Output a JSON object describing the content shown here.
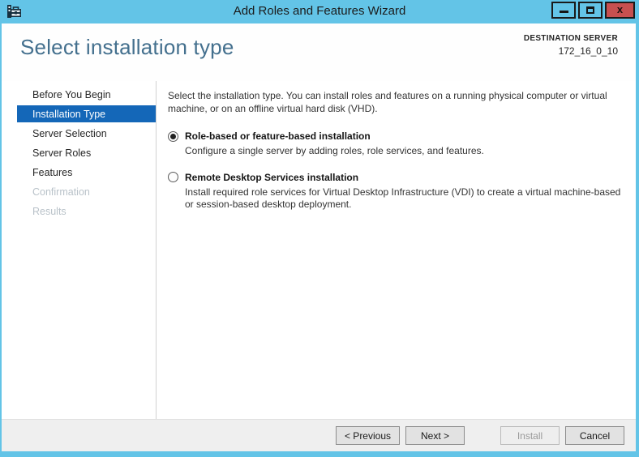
{
  "window": {
    "title": "Add Roles and Features Wizard",
    "controls": {
      "minimize_icon": "minimize-dash",
      "maximize_icon": "maximize-square",
      "close_label": "x"
    }
  },
  "header": {
    "title": "Select installation type",
    "destination_label": "DESTINATION SERVER",
    "destination_value": "172_16_0_10"
  },
  "sidebar": {
    "items": [
      {
        "label": "Before You Begin",
        "state": "enabled"
      },
      {
        "label": "Installation Type",
        "state": "selected"
      },
      {
        "label": "Server Selection",
        "state": "enabled"
      },
      {
        "label": "Server Roles",
        "state": "enabled"
      },
      {
        "label": "Features",
        "state": "enabled"
      },
      {
        "label": "Confirmation",
        "state": "disabled"
      },
      {
        "label": "Results",
        "state": "disabled"
      }
    ]
  },
  "main": {
    "intro": "Select the installation type. You can install roles and features on a running physical computer or virtual machine, or on an offline virtual hard disk (VHD).",
    "options": [
      {
        "label": "Role-based or feature-based installation",
        "description": "Configure a single server by adding roles, role services, and features.",
        "selected": true
      },
      {
        "label": "Remote Desktop Services installation",
        "description": "Install required role services for Virtual Desktop Infrastructure (VDI) to create a virtual machine-based or session-based desktop deployment.",
        "selected": false
      }
    ]
  },
  "footer": {
    "previous_label": "< Previous",
    "next_label": "Next >",
    "install_label": "Install",
    "cancel_label": "Cancel",
    "install_enabled": false
  },
  "colors": {
    "titlebar": "#63c4e7",
    "close_button": "#c75050",
    "header_title": "#44708e",
    "nav_selected_bg": "#1467b8",
    "disabled_text": "#b9c2c9"
  }
}
